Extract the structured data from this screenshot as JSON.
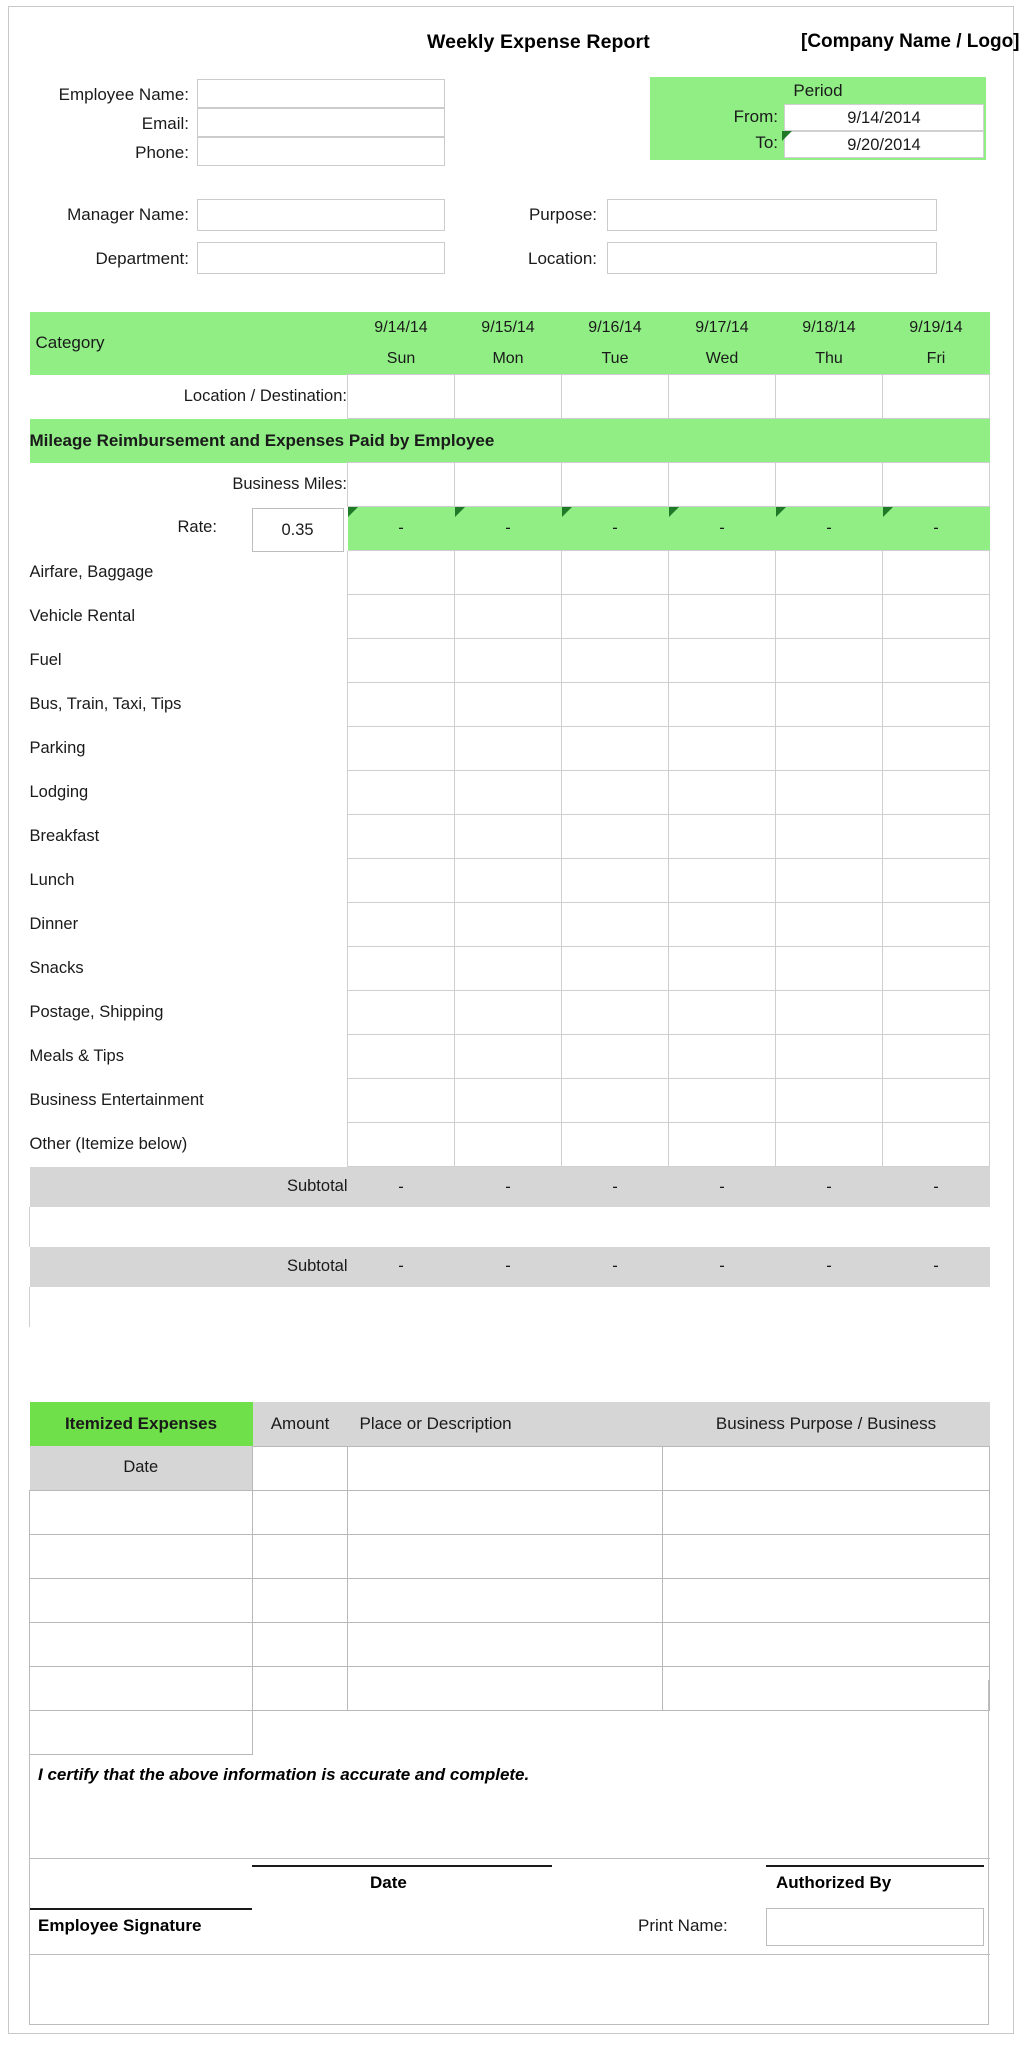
{
  "document": {
    "title": "Weekly Expense Report",
    "company_logo": "[Company Name / Logo]"
  },
  "employee_info": {
    "employee_name_label": "Employee Name:",
    "employee_name_value": "",
    "email_label": "Email:",
    "email_value": "",
    "phone_label": "Phone:",
    "phone_value": "",
    "manager_name_label": "Manager Name:",
    "manager_name_value": "",
    "department_label": "Department:",
    "department_value": "",
    "purpose_label": "Purpose:",
    "purpose_value": "",
    "location_label": "Location:",
    "location_value": ""
  },
  "period": {
    "title": "Period",
    "from_label": "From:",
    "from_value": "9/14/2014",
    "to_label": "To:",
    "to_value": "9/20/2014"
  },
  "expense_table": {
    "category_header": "Category",
    "days": [
      {
        "date": "9/14/14",
        "day": "Sun"
      },
      {
        "date": "9/15/14",
        "day": "Mon"
      },
      {
        "date": "9/16/14",
        "day": "Tue"
      },
      {
        "date": "9/17/14",
        "day": "Wed"
      },
      {
        "date": "9/18/14",
        "day": "Thu"
      },
      {
        "date": "9/19/14",
        "day": "Fri"
      }
    ],
    "location_destination_label": "Location / Destination:",
    "mileage_section_title": "Mileage Reimbursement and Expenses Paid by Employee",
    "business_miles_label": "Business Miles:",
    "rate_label": "Rate:",
    "rate_value": "0.35",
    "mileage_totals": [
      "-",
      "-",
      "-",
      "-",
      "-",
      "-"
    ],
    "categories": [
      "Airfare, Baggage",
      "Vehicle Rental",
      "Fuel",
      "Bus, Train, Taxi, Tips",
      "Parking",
      "Lodging",
      "Breakfast",
      "Lunch",
      "Dinner",
      "Snacks",
      "Postage, Shipping",
      "Meals & Tips",
      "Business Entertainment",
      "Other (Itemize below)"
    ],
    "subtotal_label": "Subtotal",
    "subtotal_1_values": [
      "-",
      "-",
      "-",
      "-",
      "-",
      "-"
    ],
    "subtotal_2_values": [
      "-",
      "-",
      "-",
      "-",
      "-",
      "-"
    ]
  },
  "itemized": {
    "title": "Itemized Expenses",
    "amount_header": "Amount",
    "place_header": "Place or Description",
    "business_purpose_header": "Business Purpose / Business",
    "date_header": "Date",
    "row_count": 6
  },
  "footer": {
    "certify_text": "I certify that the above information is accurate and complete.",
    "employee_signature_label": "Employee Signature",
    "date_label": "Date",
    "authorized_by_label": "Authorized By",
    "print_name_label": "Print Name:",
    "print_name_value": ""
  },
  "colors": {
    "header_green": "#90ee85",
    "itemized_green": "#6fe04a",
    "subtotal_gray": "#d6d6d6",
    "border_gray": "#cfcfcf"
  }
}
